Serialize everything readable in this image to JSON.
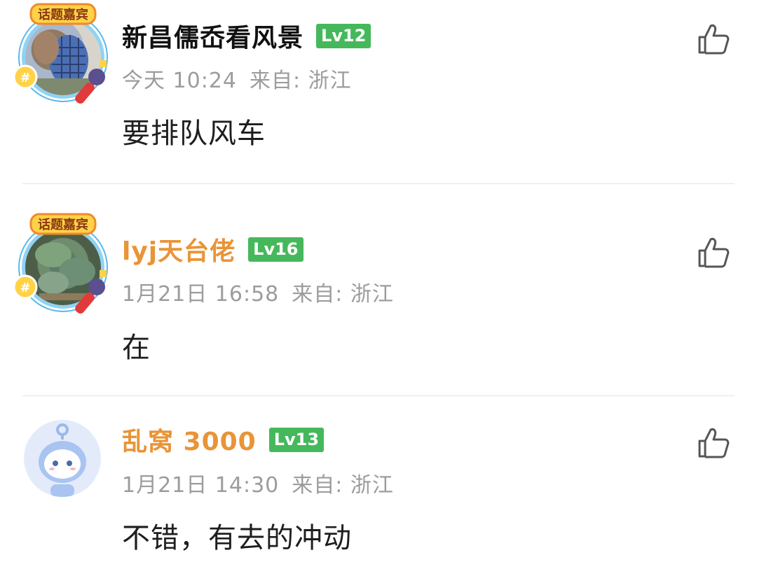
{
  "comments": [
    {
      "username": "新昌儒岙看风景",
      "level": "Lv12",
      "time": "今天 10:24",
      "location": "来自: 浙江",
      "text": "要排队风车",
      "avatar_badge": "话题嘉宾",
      "avatar_icon": "topic-guest-avatar-frame",
      "name_color": "#111111"
    },
    {
      "username": "lyj天台佬",
      "level": "Lv16",
      "time": "1月21日 16:58",
      "location": "来自: 浙江",
      "text": "在",
      "avatar_badge": "话题嘉宾",
      "avatar_icon": "topic-guest-avatar-frame",
      "name_color": "#e99437"
    },
    {
      "username": "乱窝 3000",
      "level": "Lv13",
      "time": "1月21日 14:30",
      "location": "来自: 浙江",
      "text": "不错，有去的冲动",
      "avatar_icon": "default-cartoon-avatar",
      "name_color": "#e99437"
    }
  ],
  "icons": {
    "like": "thumbs-up-icon"
  },
  "colors": {
    "level_badge": "#46b85c",
    "meta_text": "#9c9c9c",
    "vip_name": "#e99437",
    "divider": "#e4e4e4"
  }
}
